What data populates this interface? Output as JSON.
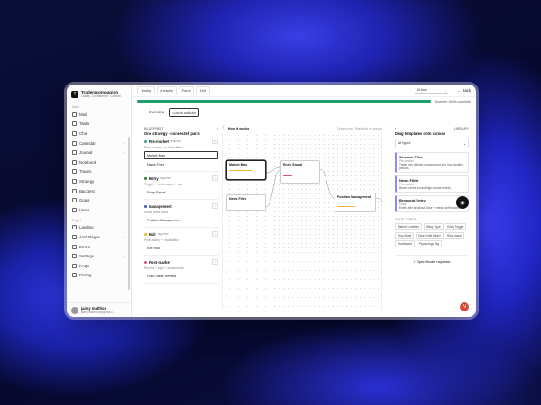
{
  "brand": {
    "name": "Traderscompanion",
    "tagline": "Clarity. Confidence. Control."
  },
  "sidebar": {
    "section_main": "Main",
    "main_items": [
      {
        "label": "Mail",
        "icon": "mail-icon"
      },
      {
        "label": "Tasks",
        "icon": "checkbox-icon"
      },
      {
        "label": "Chat",
        "icon": "chat-icon"
      },
      {
        "label": "Calendar",
        "icon": "calendar-icon",
        "chevron": ">"
      },
      {
        "label": "Journal",
        "icon": "book-icon",
        "chevron": ">"
      },
      {
        "label": "Notebook",
        "icon": "notebook-icon"
      },
      {
        "label": "Trades",
        "icon": "trades-icon"
      },
      {
        "label": "Strategy",
        "icon": "strategy-icon"
      },
      {
        "label": "Backtest",
        "icon": "backtest-icon"
      },
      {
        "label": "Goals",
        "icon": "target-icon"
      },
      {
        "label": "Users",
        "icon": "users-icon"
      }
    ],
    "section_pages": "Pages",
    "page_items": [
      {
        "label": "Landing",
        "icon": "landing-icon"
      },
      {
        "label": "Auth Pages",
        "icon": "lock-icon",
        "chevron": ">"
      },
      {
        "label": "Errors",
        "icon": "error-icon",
        "chevron": ">"
      },
      {
        "label": "Settings",
        "icon": "gear-icon",
        "chevron": ">"
      },
      {
        "label": "FAQs",
        "icon": "help-icon"
      },
      {
        "label": "Pricing",
        "icon": "tag-icon"
      }
    ]
  },
  "user": {
    "name": "jaimy malthon",
    "email": "jaimy.malthon@gmail.c..."
  },
  "topbar": {
    "chips": [
      "Testing",
      "4 trades",
      "Forex",
      "15m"
    ],
    "time_filter": "All time",
    "back_label": "Back"
  },
  "progress": {
    "value": 100,
    "text": "Blueprint 100% complete"
  },
  "tabs": [
    "Overview",
    "Graph Builder"
  ],
  "blueprint": {
    "header": "BLUEPRINT",
    "title": "One strategy · connected parts",
    "stages": [
      {
        "name": "Pre-market",
        "color": "#2aa198",
        "required": "required",
        "count": "2",
        "sub": "Bias, context, no-trade filters",
        "items": [
          "Market Bias",
          "News Filter"
        ]
      },
      {
        "name": "Entry",
        "color": "#2e7d32",
        "required": "required",
        "count": "1",
        "sub": "Trigger + confirmation + risk",
        "items": [
          "Entry Signal"
        ]
      },
      {
        "name": "Management",
        "color": "#3f51b5",
        "required": "",
        "count": "1",
        "sub": "Active trade rules",
        "items": [
          "Position Management"
        ]
      },
      {
        "name": "Exit",
        "color": "#f2b632",
        "required": "required",
        "count": "1",
        "sub": "Profit-taking + invalidation",
        "items": [
          "Exit Rule"
        ]
      },
      {
        "name": "Post-market",
        "color": "#e24b8a",
        "required": "",
        "count": "1",
        "sub": "Review + tags + adjustments",
        "items": [
          "Post-Trade Review"
        ]
      }
    ]
  },
  "canvas": {
    "header": "How it works",
    "hint": "Drag to pan · Right click for options",
    "nodes": [
      {
        "title": "Market Bias"
      },
      {
        "title": "News Filter"
      },
      {
        "title": "Entry Signal"
      },
      {
        "title": "Position Management"
      }
    ]
  },
  "library": {
    "header": "LIBRARY",
    "title": "Drag templates onto canvas",
    "filter": "All types",
    "templates": [
      {
        "title": "Session Filter",
        "sub": "Pre-market",
        "desc": "Trade only defined sessions and skip low-liquidity periods."
      },
      {
        "title": "News Filter",
        "sub": "Pre-market",
        "desc": "Block entries around high-impact events."
      },
      {
        "title": "Breakout Entry",
        "sub": "Entry",
        "desc": "Enter after breakout close + retest confirmation."
      }
    ],
    "types_title": "NODE TYPES",
    "types": [
      "Market Condition",
      "Setup Type",
      "Entry Trigger",
      "Stop Mode",
      "Take Profit Model",
      "Risk Model",
      "Invalidation",
      "Psychology Tag"
    ],
    "inspector_label": "Open Node Inspector"
  }
}
